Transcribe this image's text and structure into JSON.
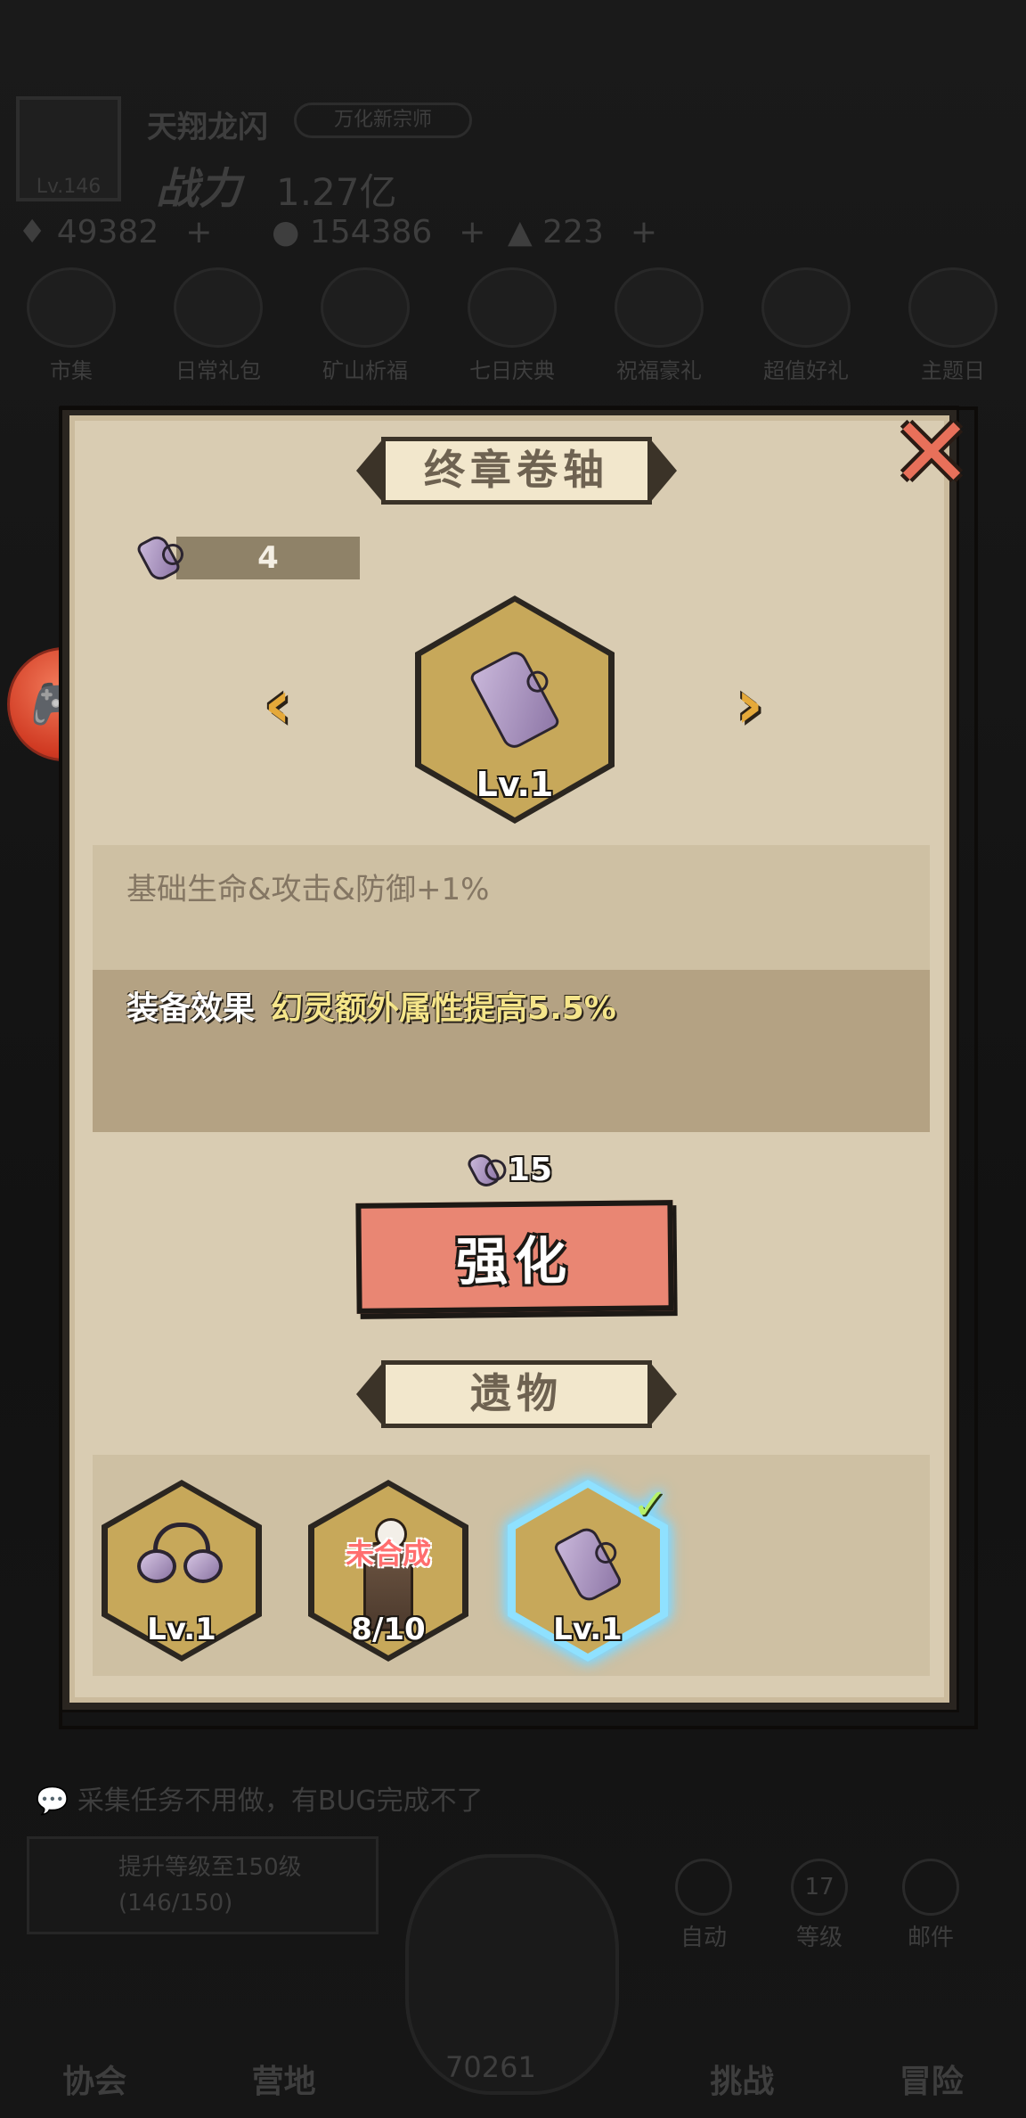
{
  "background": {
    "player_name": "天翔龙闪",
    "player_badge": "万化新宗师",
    "avatar_level": "Lv.146",
    "power_label": "战力",
    "power_value": "1.27亿",
    "currencies": [
      "49382",
      "154386",
      "223"
    ],
    "feature_icons": [
      "市集",
      "日常礼包",
      "矿山析福",
      "七日庆典",
      "祝福豪礼",
      "超值好礼",
      "主题日"
    ],
    "chat_message": "采集任务不用做，有BUG完成不了",
    "task_title": "提升等级至150级",
    "task_progress": "(146/150)",
    "side_buttons": [
      "自动",
      "等级",
      "邮件"
    ],
    "side_level": "17",
    "nav_items": [
      "协会",
      "营地",
      "挑战",
      "冒险"
    ],
    "center_value": "70261"
  },
  "dialog": {
    "title": "终章卷轴",
    "owned_count": "4",
    "item_level": "Lv.1",
    "stat_description": "基础生命&攻击&防御+1%",
    "equip_effect_label": "装备效果",
    "equip_effect_text": "幻灵额外属性提高5.5%",
    "upgrade_cost": "15",
    "enhance_button": "强化",
    "relic_section_title": "遗物",
    "relics": [
      {
        "icon": "goggles-icon",
        "label": "Lv.1",
        "badge": ""
      },
      {
        "icon": "plant-icon",
        "label": "8/10",
        "badge": "未合成"
      },
      {
        "icon": "scroll-icon",
        "label": "Lv.1",
        "badge": "",
        "selected": true
      }
    ]
  },
  "icons": {
    "close": "close-icon",
    "prev": "chevron-left-icon",
    "next": "chevron-right-icon",
    "gamepad": "gamepad-icon",
    "check": "check-icon"
  },
  "colors": {
    "panel": "#d9ccb2",
    "enhance_button": "#e98673",
    "effect_highlight": "#f5e58a",
    "hex_gold": "#c7a85a",
    "selected_glow": "#7fd7ff"
  }
}
